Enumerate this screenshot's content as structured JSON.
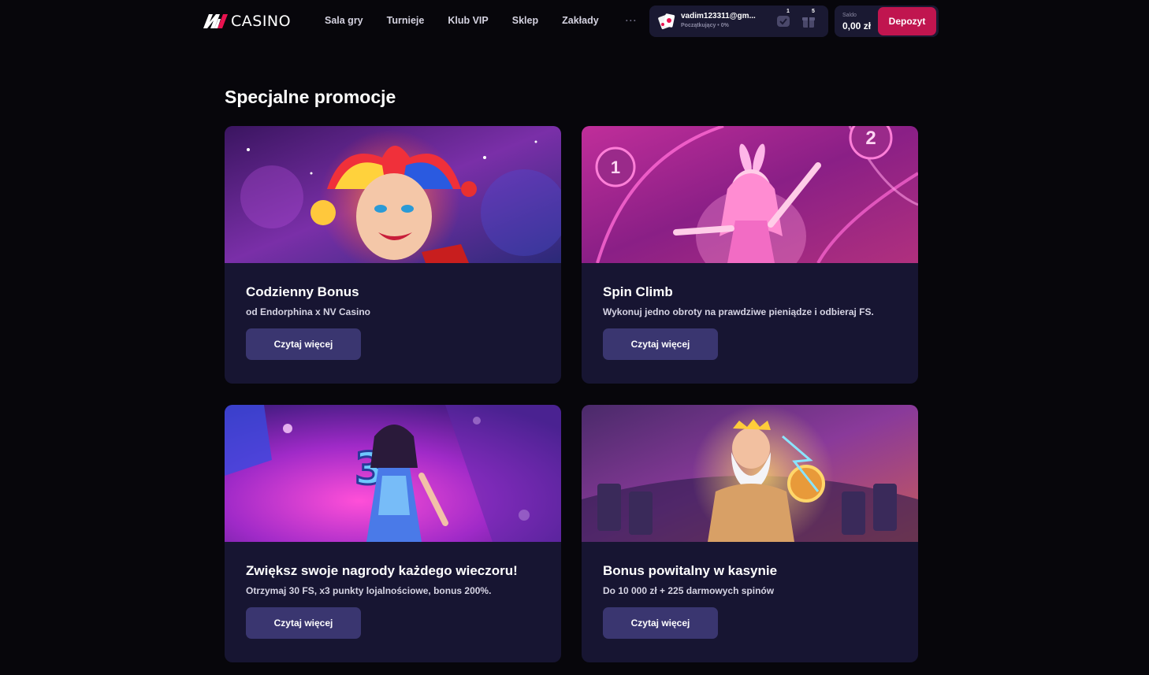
{
  "header": {
    "logo_text": "CASINO",
    "nav": [
      "Sala gry",
      "Turnieje",
      "Klub VIP",
      "Sklep",
      "Zakłady"
    ],
    "more": "···",
    "user": {
      "email": "vadim123311@gm...",
      "level": "Początkujący • 0%",
      "check_count": "1",
      "gift_count": "5"
    },
    "wallet": {
      "label": "Saldo",
      "value": "0,00 zł",
      "deposit_label": "Depozyt"
    }
  },
  "main": {
    "title": "Specjalne promocje",
    "promotions": [
      {
        "title": "Codzienny Bonus",
        "description": "od Endorphina x NV Casino",
        "button": "Czytaj więcej"
      },
      {
        "title": "Spin Climb",
        "description": "Wykonuj jedno obroty na prawdziwe pieniądze i odbieraj FS.",
        "button": "Czytaj więcej",
        "badges": [
          "1",
          "2"
        ]
      },
      {
        "title": "Zwiększ swoje nagrody każdego wieczoru!",
        "description": "Otrzymaj 30 FS, x3 punkty lojalnościowe, bonus 200%.",
        "button": "Czytaj więcej",
        "badges": [
          "3"
        ]
      },
      {
        "title": "Bonus powitalny w kasynie",
        "description": "Do 10 000 zł + 225 darmowych spinów",
        "button": "Czytaj więcej"
      }
    ]
  },
  "colors": {
    "background": "#07060b",
    "card": "#171532",
    "button": "#3a3670",
    "deposit": "#c0154f"
  }
}
